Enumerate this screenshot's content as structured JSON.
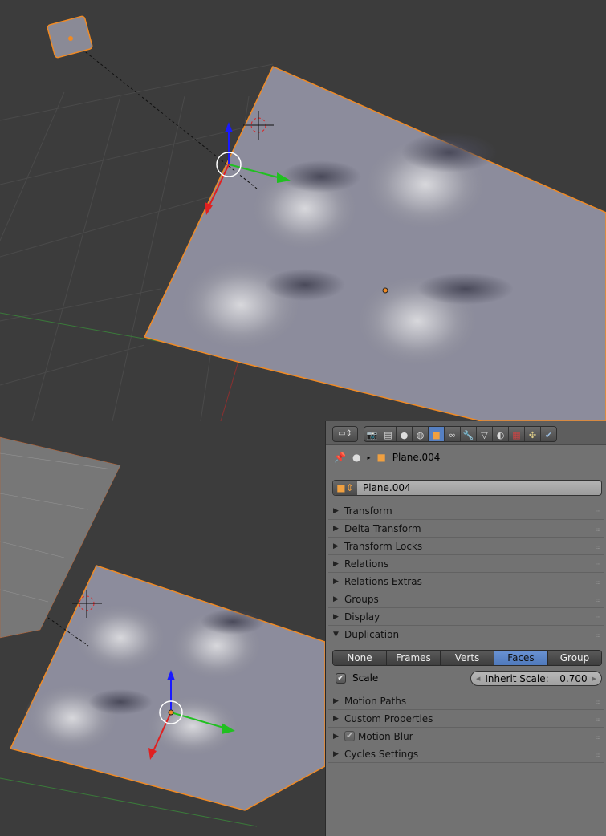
{
  "header": {
    "context_path": "Plane.004",
    "object_name": "Plane.004",
    "tabs": [
      "render",
      "render-layers",
      "scene",
      "world",
      "object",
      "constraints",
      "modifiers",
      "data",
      "material",
      "texture",
      "particles",
      "physics"
    ],
    "active_tab": "object"
  },
  "panels": [
    {
      "label": "Transform",
      "open": false
    },
    {
      "label": "Delta Transform",
      "open": false
    },
    {
      "label": "Transform Locks",
      "open": false
    },
    {
      "label": "Relations",
      "open": false
    },
    {
      "label": "Relations Extras",
      "open": false
    },
    {
      "label": "Groups",
      "open": false
    },
    {
      "label": "Display",
      "open": false
    },
    {
      "label": "Duplication",
      "open": true
    }
  ],
  "duplication": {
    "options": [
      "None",
      "Frames",
      "Verts",
      "Faces",
      "Group"
    ],
    "selected": "Faces",
    "scale_label": "Scale",
    "scale_checked": true,
    "inherit_label": "Inherit Scale:",
    "inherit_value": "0.700"
  },
  "panels_after": [
    {
      "label": "Motion Paths"
    },
    {
      "label": "Custom Properties"
    },
    {
      "label": "Motion Blur",
      "checkbox": true
    },
    {
      "label": "Cycles Settings"
    }
  ],
  "colors": {
    "accent": "#5680c2",
    "selection": "#f08a24",
    "panel_bg": "#727272",
    "viewport_bg": "#3c3c3c"
  }
}
